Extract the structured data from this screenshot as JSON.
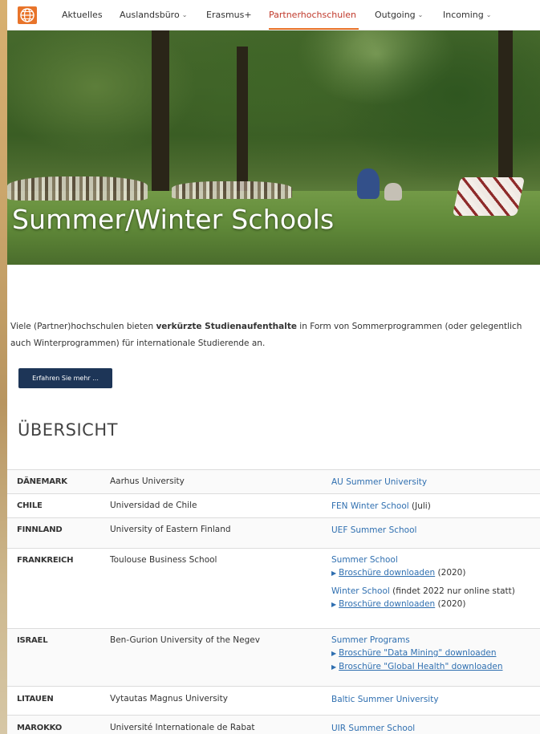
{
  "nav": {
    "items": [
      {
        "label": "Aktuelles",
        "dropdown": false
      },
      {
        "label": "Auslandsbüro",
        "dropdown": true
      },
      {
        "label": "Erasmus+",
        "dropdown": false
      },
      {
        "label": "Partnerhochschulen",
        "dropdown": false,
        "active": true
      },
      {
        "label": "Outgoing",
        "dropdown": true
      },
      {
        "label": "Incoming",
        "dropdown": true
      }
    ],
    "chevron": "⌄"
  },
  "hero": {
    "title": "Summer/Winter Schools"
  },
  "intro": {
    "part1": "Viele (Partner)hochschulen bieten ",
    "bold": "verkürzte Studienaufenthalte",
    "part2": " in Form von Sommerprogrammen (oder gelegentlich",
    "line2": "auch Winterprogrammen) für internationale Studierende an."
  },
  "more_button": "Erfahren Sie mehr ...",
  "overview_heading": "ÜBERSICHT",
  "colors": {
    "accent": "#e8742a",
    "link": "#2f6fb0",
    "button": "#1d3557"
  },
  "table": {
    "rows": [
      {
        "country": "DÄNEMARK",
        "university": "Aarhus University",
        "programs": [
          {
            "link": "AU Summer University"
          }
        ]
      },
      {
        "country": "CHILE",
        "university": "Universidad de Chile",
        "programs": [
          {
            "link": "FEN Winter School",
            "suffix": " (Juli)"
          }
        ]
      },
      {
        "country": "FINNLAND",
        "university": "University of Eastern Finland",
        "programs": [
          {
            "link": "UEF Summer School"
          }
        ]
      },
      {
        "country": "FRANKREICH",
        "university": "Toulouse Business School",
        "programs": [
          {
            "link": "Summer School"
          },
          {
            "bullet": "Broschüre downloaden",
            "suffix": " (2020)"
          },
          {
            "link": "Winter School",
            "suffix": " (findet 2022 nur online statt)"
          },
          {
            "bullet": "Broschüre downloaden",
            "suffix": " (2020)"
          }
        ]
      },
      {
        "country": "ISRAEL",
        "university": "Ben-Gurion University of the Negev",
        "programs": [
          {
            "link": "Summer Programs"
          },
          {
            "bullet": "Broschüre \"Data Mining\" downloaden"
          },
          {
            "bullet": "Broschüre \"Global Health\" downloaden"
          }
        ]
      },
      {
        "country": "LITAUEN",
        "university": "Vytautas Magnus University",
        "programs": [
          {
            "link": "Baltic Summer University"
          }
        ]
      },
      {
        "country": "MAROKKO",
        "university": "Université Internationale de Rabat",
        "programs": [
          {
            "link": "UIR Summer School"
          }
        ]
      }
    ]
  }
}
